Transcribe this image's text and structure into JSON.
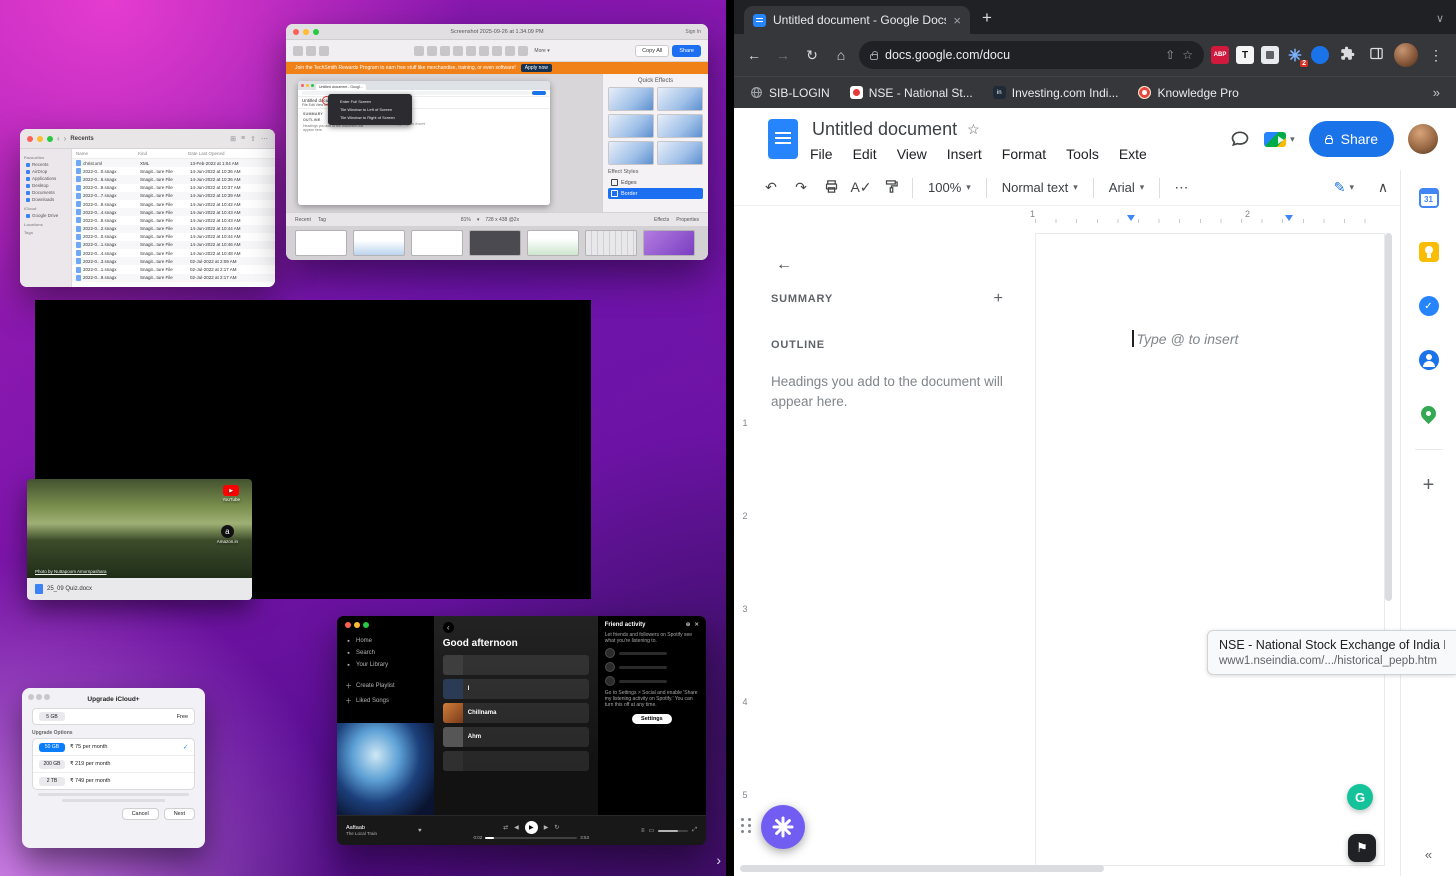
{
  "desktop": {
    "finder": {
      "window_title": "Recents",
      "sidebar": {
        "favourites": "Favourites",
        "items": [
          "Recents",
          "AirDrop",
          "Applications",
          "Desktop",
          "Documents",
          "Downloads"
        ],
        "icloud": "iCloud",
        "drive": "Google Drive",
        "locations": "Locations",
        "tags": "Tags"
      },
      "columns": [
        "Name",
        "Kind",
        "Date Last Opened"
      ],
      "rows": [
        {
          "name": "christ.xml",
          "kind": "XML",
          "date": "13-Feb-2022 at 1:04 AM"
        },
        {
          "name": "2022-0...0.snagx",
          "kind": "Snagit...ture File",
          "date": "14-Jun-2022 at 10:36 AM"
        },
        {
          "name": "2022-0...6.snagx",
          "kind": "Snagit...ture File",
          "date": "14-Jun-2022 at 10:36 AM"
        },
        {
          "name": "2022-0...9.snagx",
          "kind": "Snagit...ture File",
          "date": "14-Jun-2022 at 10:37 AM"
        },
        {
          "name": "2022-0...7.snagx",
          "kind": "Snagit...ture File",
          "date": "14-Jun-2022 at 10:39 AM"
        },
        {
          "name": "2022-0...9.snagx",
          "kind": "Snagit...ture File",
          "date": "14-Jun-2022 at 10:42 AM"
        },
        {
          "name": "2022-0...4.snagx",
          "kind": "Snagit...ture File",
          "date": "14-Jun-2022 at 10:43 AM"
        },
        {
          "name": "2022-0...8.snagx",
          "kind": "Snagit...ture File",
          "date": "14-Jun-2022 at 10:43 AM"
        },
        {
          "name": "2022-0...2.snagx",
          "kind": "Snagit...ture File",
          "date": "14-Jun-2022 at 10:44 AM"
        },
        {
          "name": "2022-0...0.snagx",
          "kind": "Snagit...ture File",
          "date": "14-Jun-2022 at 10:44 AM"
        },
        {
          "name": "2022-0...1.snagx",
          "kind": "Snagit...ture File",
          "date": "14-Jun-2022 at 10:46 AM"
        },
        {
          "name": "2022-0...4.snagx",
          "kind": "Snagit...ture File",
          "date": "14-Jun-2022 at 10:48 AM"
        },
        {
          "name": "2022-0...3.snagx",
          "kind": "Snagit...ture File",
          "date": "02-Jul-2022 at 2:09 AM"
        },
        {
          "name": "2022-0...1.snagx",
          "kind": "Snagit...ture File",
          "date": "02-Jul-2022 at 2:17 AM"
        },
        {
          "name": "2022-0...9.snagx",
          "kind": "Snagit...ture File",
          "date": "02-Jul-2022 at 2:17 AM"
        }
      ]
    },
    "snagit": {
      "window_title": "Screenshot 2025-09-26 at 1.34.09 PM",
      "sign_in": "Sign In",
      "more_label": "More",
      "copy_all": "Copy All",
      "share": "Share",
      "banner_text": "Join the TechSmith Rewards Program to earn free stuff like merchandise, training, or even software!",
      "banner_cta": "Apply now",
      "preview": {
        "tab_title": "Untitled document - Googl...",
        "doc_title": "Untitled document",
        "menus": "File   Edit   View   Insert   Format   Tools   Extensions   Help",
        "summary": "SUMMARY",
        "outline": "OUTLINE",
        "outline_hint": "Headings you add to the document will appear here.",
        "placeholder": "Type @ to insert",
        "context_menu": [
          "Enter Full Screen",
          "Tile Window to Left of Screen",
          "Tile Window to Right of Screen"
        ]
      },
      "effects": {
        "title": "Quick Effects",
        "styles_title": "Effect Styles",
        "edges": "Edges",
        "border": "Border"
      },
      "status": {
        "recent": "Recent",
        "tag": "Tag",
        "zoom": "81%",
        "dimensions": "728 x 438 @2x",
        "effects": "Effects",
        "properties": "Properties"
      }
    },
    "photo_card": {
      "youtube": "YouTube",
      "amazon": "Amazon.in",
      "amazon_initial": "a",
      "credit": "Photo by Nuttapoom Amornpashara",
      "file_label": "25_09 Quiz.docx"
    },
    "icloud": {
      "title": "Upgrade iCloud+",
      "current_size": "5 GB",
      "current_price": "Free",
      "options_label": "Upgrade Options",
      "plans": [
        {
          "size": "50 GB",
          "price": "₹ 75 per month",
          "check": "✓"
        },
        {
          "size": "200 GB",
          "price": "₹ 219 per month",
          "check": ""
        },
        {
          "size": "2 TB",
          "price": "₹ 749 per month",
          "check": ""
        }
      ],
      "cancel": "Cancel",
      "next": "Next"
    },
    "spotify": {
      "nav": [
        "Home",
        "Search",
        "Your Library"
      ],
      "playlists": [
        "Create Playlist",
        "Liked Songs"
      ],
      "greeting": "Good afternoon",
      "tiles": [
        "",
        "I",
        "Chillnama",
        "Ahm",
        ""
      ],
      "friends": {
        "title": "Friend activity",
        "intro": "Let friends and followers on Spotify see what you're listening to.",
        "hint": "Go to Settings > Social and enable 'Share my listening activity on Spotify.' You can turn this off at any time.",
        "settings": "Settings"
      },
      "player": {
        "track": "Aaftaab",
        "artist": "The Local Train",
        "elapsed": "0:02",
        "duration": "3:53"
      }
    }
  },
  "chrome": {
    "tab_title": "Untitled document - Google Docs",
    "address": "docs.google.com/docu",
    "abp_label": "ABP",
    "t_label": "T",
    "in_label": "in",
    "ext_badge": "2",
    "bookmarks": {
      "b1": "SIB-LOGIN",
      "b2": "NSE - National St...",
      "b3": "Investing.com Indi...",
      "b4": "Knowledge Pro"
    },
    "docs": {
      "title": "Untitled document",
      "menus": [
        "File",
        "Edit",
        "View",
        "Insert",
        "Format",
        "Tools",
        "Extensions"
      ],
      "share_label": "Share",
      "zoom": "100%",
      "para_style": "Normal text",
      "font_name": "Arial",
      "summary_label": "SUMMARY",
      "outline_label": "OUTLINE",
      "outline_hint": "Headings you add to the document will appear here.",
      "placeholder": "Type @ to insert",
      "h_ruler": [
        "1",
        "2"
      ],
      "v_ruler": [
        "1",
        "2",
        "3",
        "4",
        "5"
      ],
      "calendar_day": "31"
    },
    "grammarly": "G",
    "tooltip": {
      "title": "NSE - National Stock Exchange of India Ltd.",
      "url": "www1.nseindia.com/.../historical_pepb.htm"
    }
  }
}
